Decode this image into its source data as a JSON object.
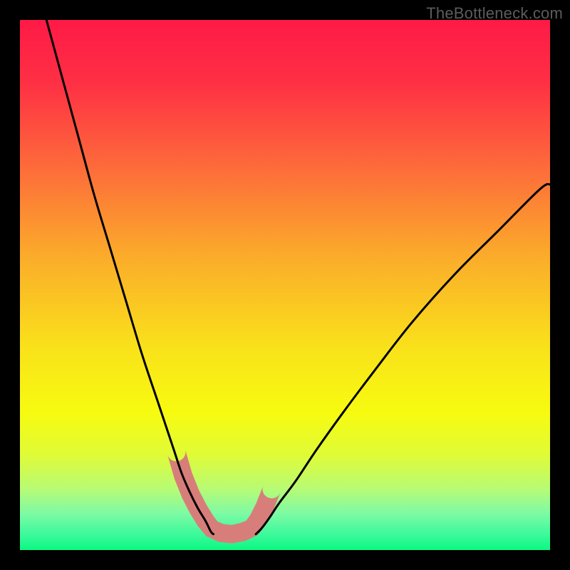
{
  "watermark": "TheBottleneck.com",
  "chart_data": {
    "type": "line",
    "title": "",
    "xlabel": "",
    "ylabel": "",
    "xlim": [
      0,
      100
    ],
    "ylim": [
      0,
      100
    ],
    "series": [
      {
        "name": "left-curve",
        "x": [
          5,
          8,
          11,
          14,
          17,
          20,
          23,
          26,
          29,
          30.5,
          32,
          33.5,
          35,
          36,
          36.5
        ],
        "y": [
          100,
          89,
          78,
          67,
          57,
          47,
          37,
          28,
          19,
          14.5,
          11,
          8,
          5.5,
          3.5,
          3
        ]
      },
      {
        "name": "right-curve",
        "x": [
          44.5,
          45.5,
          47,
          49,
          52,
          56,
          61,
          67,
          74,
          82,
          90,
          98,
          100
        ],
        "y": [
          3,
          4,
          6,
          9,
          13,
          19,
          26,
          34,
          43,
          52,
          60,
          68,
          69
        ]
      },
      {
        "name": "marker-band",
        "shape": "v-band",
        "x_range": [
          30,
          46
        ],
        "y_range": [
          3,
          19
        ],
        "color": "#d77e7b"
      }
    ],
    "background_gradient": {
      "stops": [
        {
          "offset": 0.0,
          "color": "#fe1a46"
        },
        {
          "offset": 0.12,
          "color": "#fe3044"
        },
        {
          "offset": 0.28,
          "color": "#fd6c3a"
        },
        {
          "offset": 0.45,
          "color": "#fbad2a"
        },
        {
          "offset": 0.62,
          "color": "#f9e21a"
        },
        {
          "offset": 0.74,
          "color": "#f7fb10"
        },
        {
          "offset": 0.82,
          "color": "#e0fb36"
        },
        {
          "offset": 0.885,
          "color": "#b7fb75"
        },
        {
          "offset": 0.93,
          "color": "#7ffaa4"
        },
        {
          "offset": 0.97,
          "color": "#3df99c"
        },
        {
          "offset": 1.0,
          "color": "#0cf882"
        }
      ]
    }
  }
}
